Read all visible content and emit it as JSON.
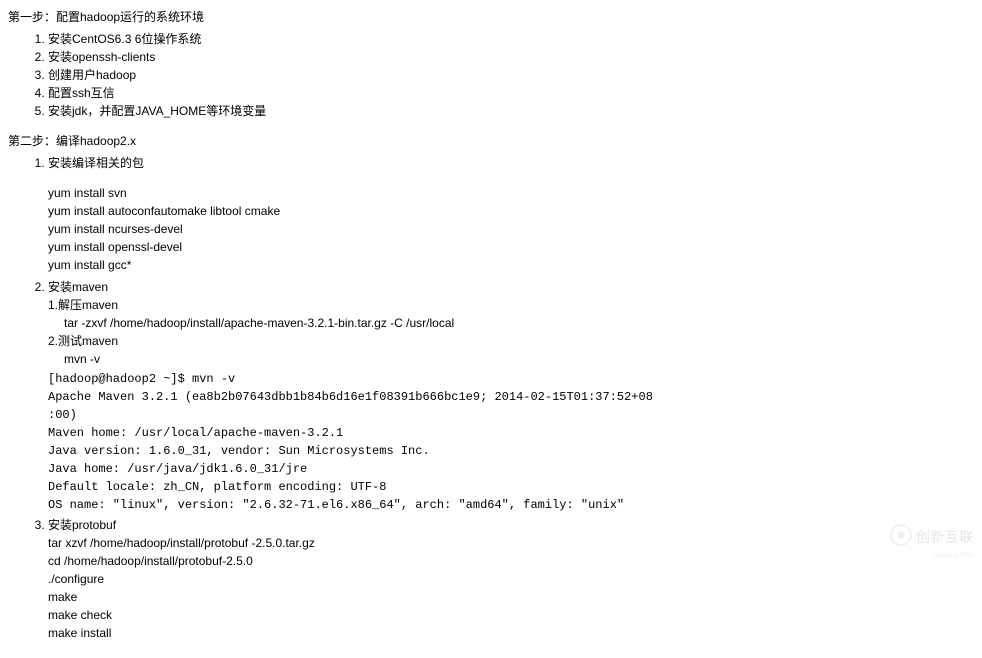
{
  "step1": {
    "title": "第一步：配置hadoop运行的系统环境",
    "items": [
      "安装CentOS6.3 6位操作系统",
      "安装openssh-clients",
      "创建用户hadoop",
      "配置ssh互信",
      "安装jdk，并配置JAVA_HOME等环境变量"
    ]
  },
  "step2": {
    "title": "第二步：编译hadoop2.x",
    "item1": {
      "label": "安装编译相关的包",
      "cmds": [
        "yum install svn",
        "yum install autoconfautomake libtool cmake",
        "yum install ncurses-devel",
        "yum install openssl-devel",
        "yum install gcc*"
      ]
    },
    "item2": {
      "label": "安装maven",
      "sub1": {
        "label": "1.解压maven",
        "cmd": "tar -zxvf /home/hadoop/install/apache-maven-3.2.1-bin.tar.gz -C /usr/local"
      },
      "sub2": {
        "label": "2.测试maven",
        "cmd": "mvn -v",
        "output": "[hadoop@hadoop2 ~]$ mvn -v\nApache Maven 3.2.1 (ea8b2b07643dbb1b84b6d16e1f08391b666bc1e9; 2014-02-15T01:37:52+08\n:00)\nMaven home: /usr/local/apache-maven-3.2.1\nJava version: 1.6.0_31, vendor: Sun Microsystems Inc.\nJava home: /usr/java/jdk1.6.0_31/jre\nDefault locale: zh_CN, platform encoding: UTF-8\nOS name: \"linux\", version: \"2.6.32-71.el6.x86_64\", arch: \"amd64\", family: \"unix\""
      }
    },
    "item3": {
      "label": "安装protobuf",
      "cmds": [
        "tar xzvf  /home/hadoop/install/protobuf -2.5.0.tar.gz",
        "cd /home/hadoop/install/protobuf-2.5.0",
        "./configure",
        "make",
        "make check",
        "make install"
      ]
    }
  },
  "watermark": {
    "text": "创新互联",
    "subtext": "CDCXHL.COM"
  }
}
